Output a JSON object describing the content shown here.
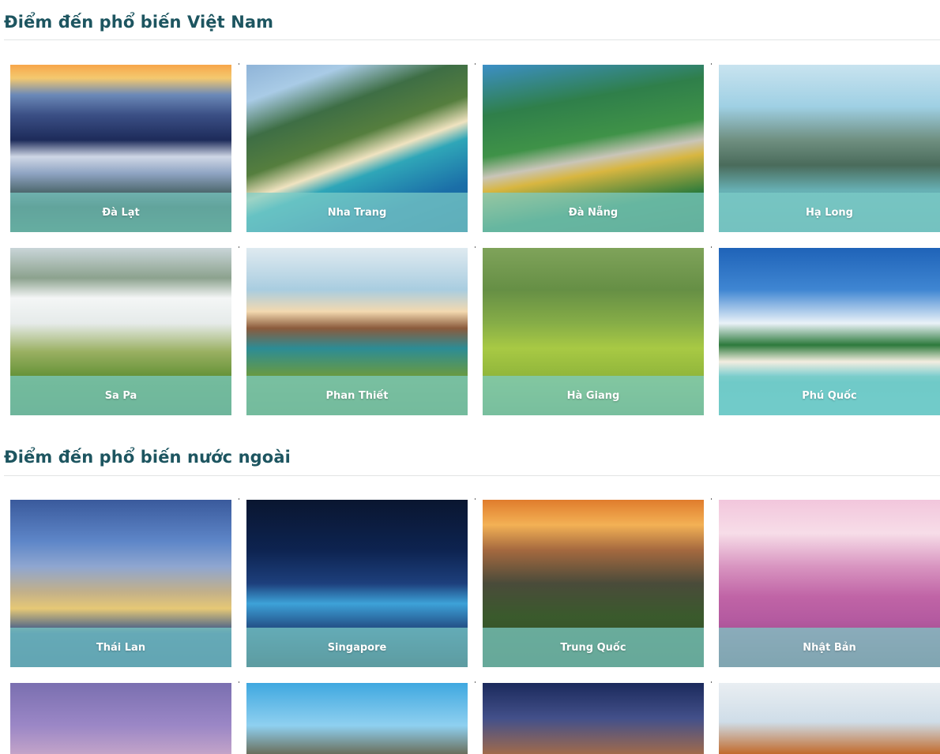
{
  "sections": [
    {
      "title": "Điểm đến phổ biến Việt Nam",
      "destinations": [
        {
          "label": "Đà Lạt"
        },
        {
          "label": "Nha Trang"
        },
        {
          "label": "Đà Nẵng"
        },
        {
          "label": "Hạ Long"
        },
        {
          "label": "Sa Pa"
        },
        {
          "label": "Phan Thiết"
        },
        {
          "label": "Hà Giang"
        },
        {
          "label": "Phú Quốc"
        }
      ]
    },
    {
      "title": "Điểm đến phổ biến nước ngoài",
      "destinations": [
        {
          "label": "Thái Lan"
        },
        {
          "label": "Singapore"
        },
        {
          "label": "Trung Quốc"
        },
        {
          "label": "Nhật Bản"
        }
      ]
    }
  ],
  "colors": {
    "heading": "#1d5560",
    "caption_overlay": "#7dcdc8",
    "caption_text": "#ffffff",
    "divider": "#e2e4e4"
  }
}
